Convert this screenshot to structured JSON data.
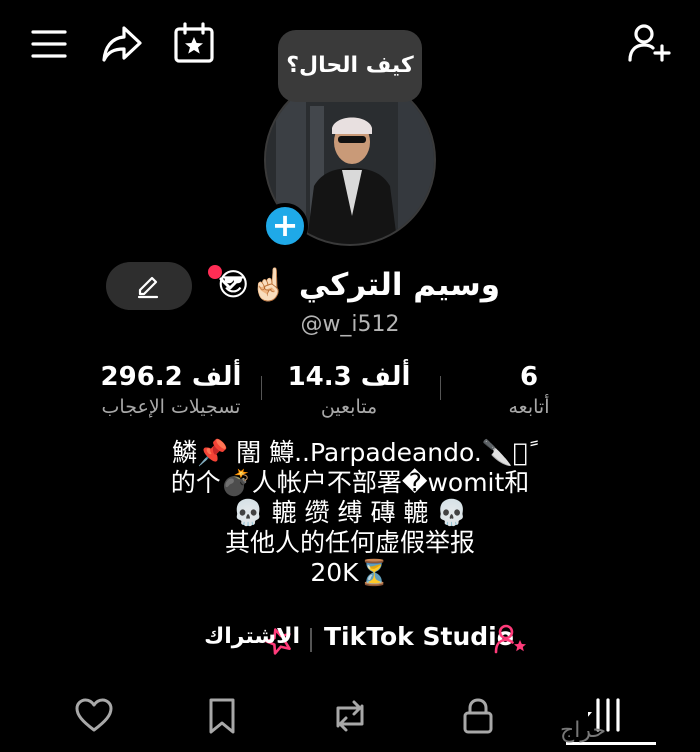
{
  "header": {
    "menu_icon": "hamburger-menu-icon",
    "share_icon": "share-arrow-icon",
    "calendar_icon": "calendar-star-icon",
    "add_user_icon": "add-user-icon"
  },
  "profile": {
    "bubble_text": "كيف الحال؟",
    "name": "وسيم التركي ☝🏻😎",
    "handle": "@w_i512",
    "add_story_label": "+"
  },
  "stats": [
    {
      "value": "296.2 ألف",
      "label": "تسجيلات الإعجاب"
    },
    {
      "value": "14.3 ألف",
      "label": "متابعين"
    },
    {
      "value": "6",
      "label": "أتابعه"
    }
  ],
  "bio": {
    "lines": [
      "鱗📌 闇 鱒..Parpadeando.🔪鱗ً",
      "的个💣人帐户不部署�womit和",
      "💀 轆 缵 缚 磚 轆 💀",
      "其他人的任何虚假举报",
      "20K⏳"
    ]
  },
  "links": {
    "subscribe_label": "الاشتراك",
    "studio_label": "TikTok Studio"
  },
  "tabs": [
    {
      "name": "liked-tab",
      "icon": "heart-icon"
    },
    {
      "name": "favorites-tab",
      "icon": "bookmark-icon"
    },
    {
      "name": "reposts-tab",
      "icon": "repost-icon"
    },
    {
      "name": "private-tab",
      "icon": "lock-icon"
    },
    {
      "name": "videos-tab",
      "icon": "grid-icon"
    }
  ],
  "watermark": "حراج",
  "colors": {
    "background": "#000000",
    "accent_blue": "#1fa9e8",
    "accent_red": "#ff2d55",
    "muted_text": "#a8a8a8"
  }
}
